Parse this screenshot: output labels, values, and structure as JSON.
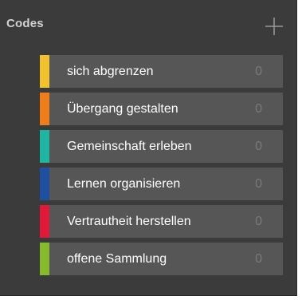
{
  "panel": {
    "title": "Codes",
    "add_icon": "plus-icon"
  },
  "codes": [
    {
      "label": "sich abgrenzen",
      "count": "0",
      "color": "#f2c12e"
    },
    {
      "label": "Übergang gestalten",
      "count": "0",
      "color": "#ef7d1a"
    },
    {
      "label": "Gemeinschaft erleben",
      "count": "0",
      "color": "#1fb5a3"
    },
    {
      "label": "Lernen organisieren",
      "count": "0",
      "color": "#1f4fa0"
    },
    {
      "label": "Vertrautheit herstellen",
      "count": "0",
      "color": "#e0183a"
    },
    {
      "label": "offene Sammlung",
      "count": "0",
      "color": "#86b92b"
    }
  ]
}
